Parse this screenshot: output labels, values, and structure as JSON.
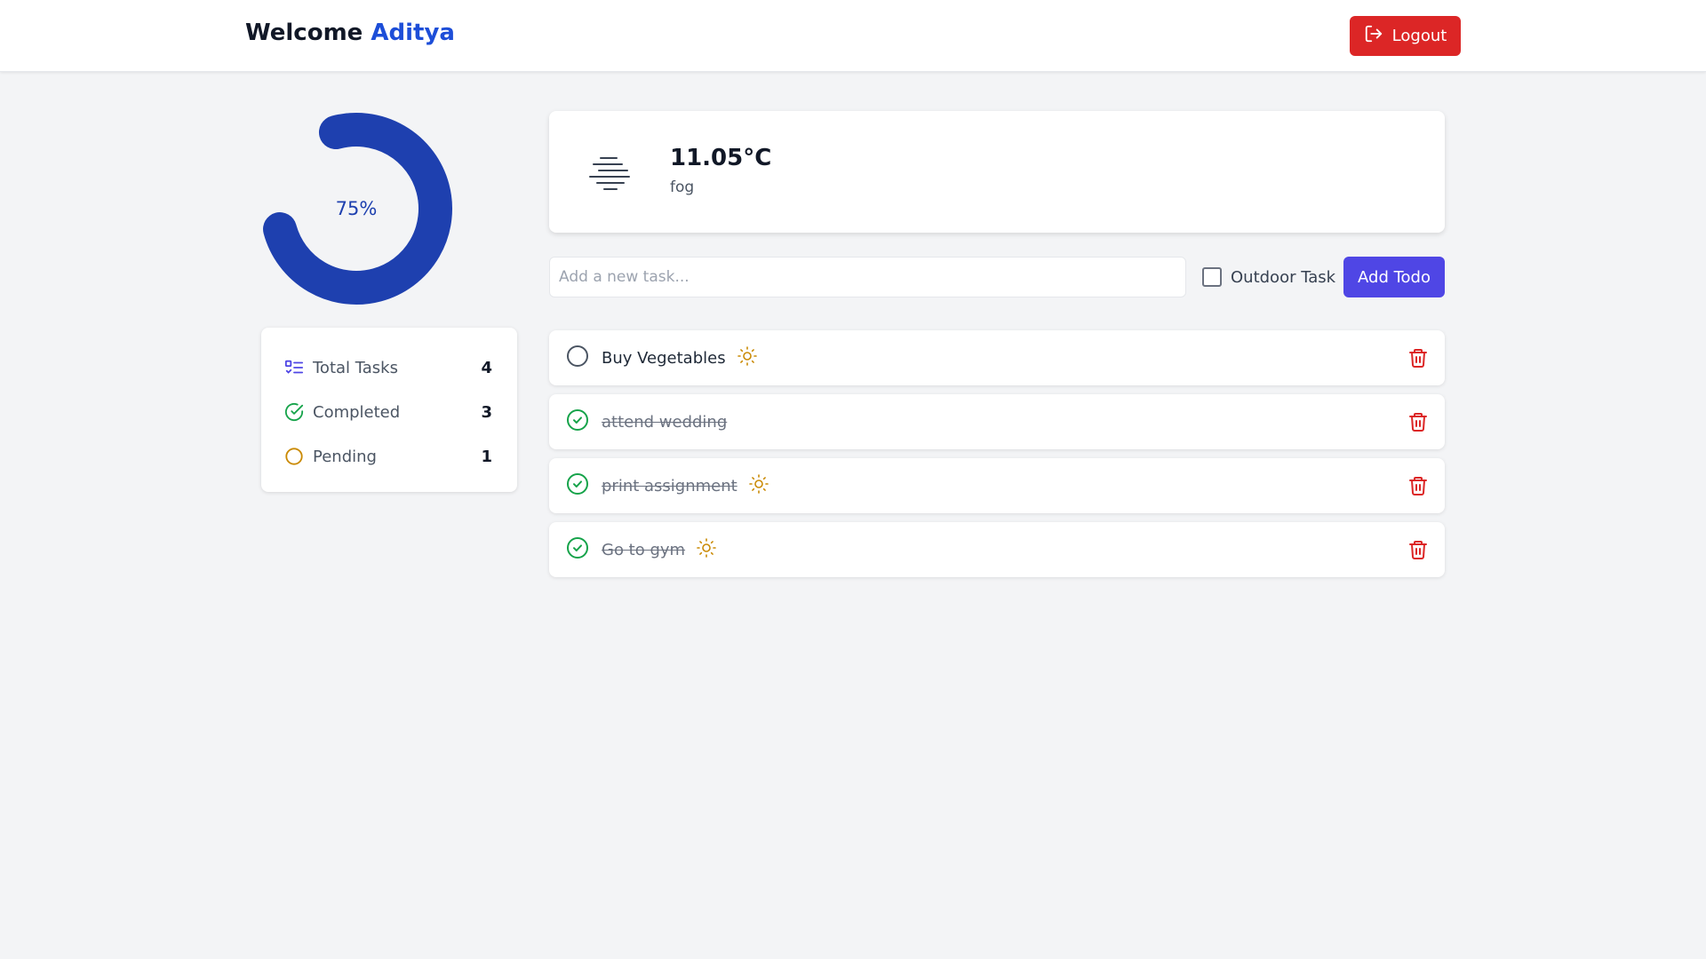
{
  "header": {
    "welcome_text": "Welcome",
    "user_name": "Aditya",
    "logout_label": "Logout",
    "logout_icon": "logout-icon"
  },
  "progress": {
    "percent": 75,
    "label": "75%",
    "color": "#1e40af"
  },
  "stats": [
    {
      "key": "total",
      "label": "Total Tasks",
      "value": "4",
      "icon": "list-icon"
    },
    {
      "key": "completed",
      "label": "Completed",
      "value": "3",
      "icon": "check-circle-icon"
    },
    {
      "key": "pending",
      "label": "Pending",
      "value": "1",
      "icon": "circle-icon"
    }
  ],
  "weather": {
    "temperature": "11.05°C",
    "condition": "fog",
    "icon": "fog-icon"
  },
  "new_task": {
    "placeholder": "Add a new task...",
    "outdoor_label": "Outdoor Task",
    "outdoor_checked": false,
    "add_label": "Add Todo"
  },
  "todos": [
    {
      "text": "Buy Vegetables",
      "completed": false,
      "outdoor": true
    },
    {
      "text": "attend wedding",
      "completed": true,
      "outdoor": false
    },
    {
      "text": "print assignment",
      "completed": true,
      "outdoor": true
    },
    {
      "text": "Go to gym",
      "completed": true,
      "outdoor": true
    }
  ],
  "colors": {
    "brand_blue": "#1d4ed8",
    "danger": "#dc2626",
    "primary_button": "#4f46e5",
    "success": "#16a34a",
    "warning": "#ca8a04"
  }
}
